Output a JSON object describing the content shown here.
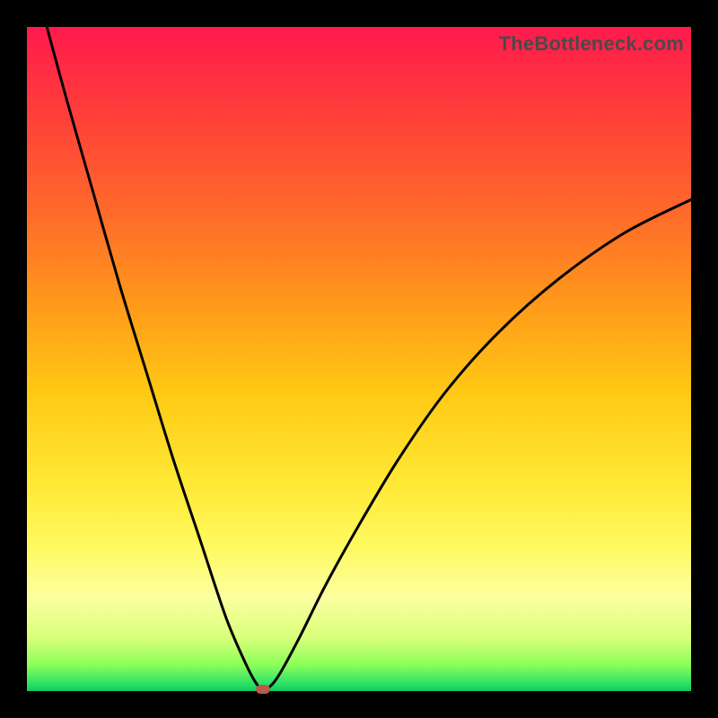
{
  "watermark": "TheBottleneck.com",
  "chart_data": {
    "type": "line",
    "title": "",
    "xlabel": "",
    "ylabel": "",
    "xlim": [
      0,
      100
    ],
    "ylim": [
      0,
      100
    ],
    "series": [
      {
        "name": "curve",
        "x": [
          3,
          6,
          10,
          14,
          18,
          22,
          26,
          30,
          33,
          34.5,
          35.5,
          36.5,
          38,
          41,
          45,
          50,
          56,
          63,
          71,
          80,
          90,
          100
        ],
        "y": [
          100,
          89,
          75,
          61,
          48,
          35,
          23,
          11,
          4,
          1.2,
          0.2,
          0.6,
          2.5,
          8,
          16,
          25,
          35,
          45,
          54,
          62,
          69,
          74
        ]
      }
    ],
    "marker": {
      "x": 35.5,
      "y": 0.3
    },
    "gradient_stops": [
      {
        "pos": 0,
        "color": "#ff1a4d"
      },
      {
        "pos": 12,
        "color": "#ff3b3b"
      },
      {
        "pos": 28,
        "color": "#ff6a2a"
      },
      {
        "pos": 42,
        "color": "#ff9a1a"
      },
      {
        "pos": 55,
        "color": "#ffc914"
      },
      {
        "pos": 68,
        "color": "#ffe733"
      },
      {
        "pos": 78,
        "color": "#fff95e"
      },
      {
        "pos": 86,
        "color": "#fbffa0"
      },
      {
        "pos": 92,
        "color": "#d8ff7a"
      },
      {
        "pos": 96,
        "color": "#8dff5a"
      },
      {
        "pos": 99,
        "color": "#29e066"
      },
      {
        "pos": 100,
        "color": "#0fc95f"
      }
    ]
  }
}
